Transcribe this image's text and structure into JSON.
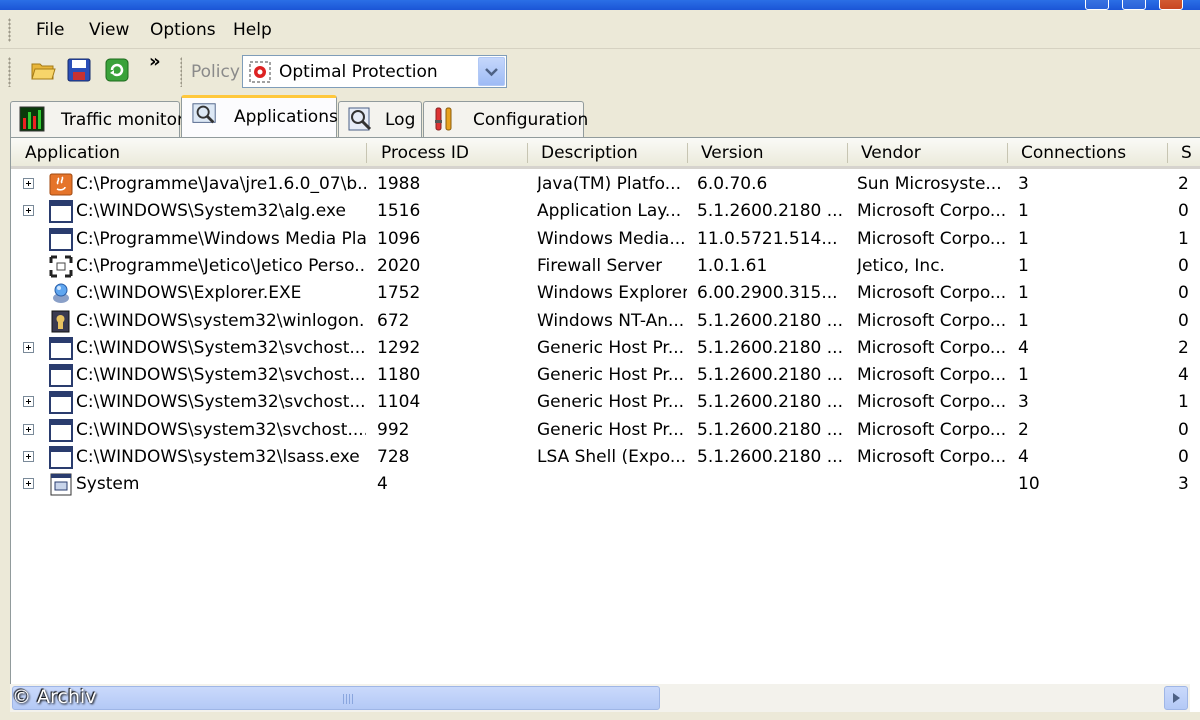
{
  "menu": {
    "items": [
      "File",
      "View",
      "Options",
      "Help"
    ]
  },
  "toolbar": {
    "overflow_label": "»",
    "policy_label": "Policy",
    "policy_value": "Optimal Protection"
  },
  "tabs": [
    {
      "label": "Traffic monitor",
      "icon": "traffic-monitor-icon"
    },
    {
      "label": "Applications",
      "icon": "applications-icon",
      "active": true
    },
    {
      "label": "Log",
      "icon": "log-icon"
    },
    {
      "label": "Configuration",
      "icon": "configuration-icon"
    }
  ],
  "table": {
    "columns": [
      "Application",
      "Process ID",
      "Description",
      "Version",
      "Vendor",
      "Connections",
      "S"
    ],
    "rows": [
      {
        "expandable": true,
        "icon": "java-icon",
        "application": "C:\\Programme\\Java\\jre1.6.0_07\\b...",
        "pid": "1988",
        "description": "Java(TM) Platfo...",
        "version": "6.0.70.6",
        "vendor": "Sun Microsyste...",
        "connections": "3",
        "extra": "2"
      },
      {
        "expandable": true,
        "icon": "window-icon",
        "application": "C:\\WINDOWS\\System32\\alg.exe",
        "pid": "1516",
        "description": "Application Lay...",
        "version": "5.1.2600.2180 ...",
        "vendor": "Microsoft Corpo...",
        "connections": "1",
        "extra": "0"
      },
      {
        "expandable": false,
        "icon": "window-icon",
        "application": "C:\\Programme\\Windows Media Pla...",
        "pid": "1096",
        "description": "Windows Media...",
        "version": "11.0.5721.514...",
        "vendor": "Microsoft Corpo...",
        "connections": "1",
        "extra": "1"
      },
      {
        "expandable": false,
        "icon": "firewall-icon",
        "application": "C:\\Programme\\Jetico\\Jetico Perso...",
        "pid": "2020",
        "description": "Firewall Server",
        "version": "1.0.1.61",
        "vendor": "Jetico, Inc.",
        "connections": "1",
        "extra": "0"
      },
      {
        "expandable": false,
        "icon": "explorer-icon",
        "application": "C:\\WINDOWS\\Explorer.EXE",
        "pid": "1752",
        "description": "Windows Explorer",
        "version": "6.00.2900.315...",
        "vendor": "Microsoft Corpo...",
        "connections": "1",
        "extra": "0"
      },
      {
        "expandable": false,
        "icon": "winlogon-icon",
        "application": "C:\\WINDOWS\\system32\\winlogon....",
        "pid": "672",
        "description": "Windows NT-An...",
        "version": "5.1.2600.2180 ...",
        "vendor": "Microsoft Corpo...",
        "connections": "1",
        "extra": "0"
      },
      {
        "expandable": true,
        "icon": "window-icon",
        "application": "C:\\WINDOWS\\System32\\svchost....",
        "pid": "1292",
        "description": "Generic Host Pr...",
        "version": "5.1.2600.2180 ...",
        "vendor": "Microsoft Corpo...",
        "connections": "4",
        "extra": "2"
      },
      {
        "expandable": false,
        "icon": "window-icon",
        "application": "C:\\WINDOWS\\System32\\svchost....",
        "pid": "1180",
        "description": "Generic Host Pr...",
        "version": "5.1.2600.2180 ...",
        "vendor": "Microsoft Corpo...",
        "connections": "1",
        "extra": "4"
      },
      {
        "expandable": true,
        "icon": "window-icon",
        "application": "C:\\WINDOWS\\System32\\svchost....",
        "pid": "1104",
        "description": "Generic Host Pr...",
        "version": "5.1.2600.2180 ...",
        "vendor": "Microsoft Corpo...",
        "connections": "3",
        "extra": "1"
      },
      {
        "expandable": true,
        "icon": "window-icon",
        "application": "C:\\WINDOWS\\system32\\svchost....",
        "pid": "992",
        "description": "Generic Host Pr...",
        "version": "5.1.2600.2180 ...",
        "vendor": "Microsoft Corpo...",
        "connections": "2",
        "extra": "0"
      },
      {
        "expandable": true,
        "icon": "window-icon",
        "application": "C:\\WINDOWS\\system32\\lsass.exe",
        "pid": "728",
        "description": "LSA Shell (Expo...",
        "version": "5.1.2600.2180 ...",
        "vendor": "Microsoft Corpo...",
        "connections": "4",
        "extra": "0"
      },
      {
        "expandable": true,
        "icon": "system-icon",
        "application": "System",
        "pid": "4",
        "description": "",
        "version": "",
        "vendor": "",
        "connections": "10",
        "extra": "3"
      }
    ]
  },
  "watermark": "© Archiv"
}
